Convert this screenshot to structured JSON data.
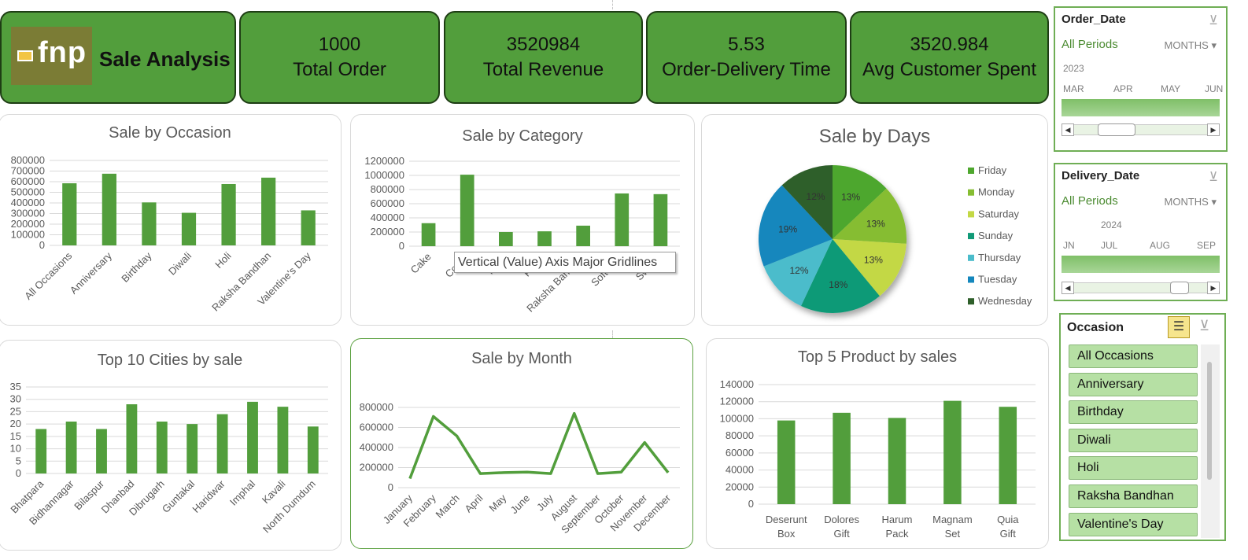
{
  "brand": {
    "logo_text": "fnp",
    "title": "Sale Analysis"
  },
  "kpis": [
    {
      "value": "1000",
      "label": "Total Order"
    },
    {
      "value": "3520984",
      "label": "Total Revenue"
    },
    {
      "value": "5.53",
      "label": "Order-Delivery Time"
    },
    {
      "value": "3520.984",
      "label": "Avg Customer Spent"
    }
  ],
  "colors": {
    "bar": "#529e3c",
    "line": "#529e3c",
    "kpi": "#529e3c",
    "kpi_border": "#1e3d14",
    "accent": "#4b8b31"
  },
  "tooltip": "Vertical (Value) Axis Major Gridlines",
  "order_date_slicer": {
    "title": "Order_Date",
    "all_periods": "All Periods",
    "unit": "MONTHS",
    "year": "2023",
    "months": [
      "MAR",
      "APR",
      "MAY",
      "JUN"
    ]
  },
  "delivery_date_slicer": {
    "title": "Delivery_Date",
    "all_periods": "All Periods",
    "unit": "MONTHS",
    "year": "2024",
    "months": [
      "JN",
      "JUL",
      "AUG",
      "SEP"
    ]
  },
  "occasion_slicer": {
    "title": "Occasion",
    "items": [
      "All Occasions",
      "Anniversary",
      "Birthday",
      "Diwali",
      "Holi",
      "Raksha Bandhan",
      "Valentine's Day"
    ]
  },
  "chart_data": [
    {
      "id": "occasion",
      "type": "bar",
      "title": "Sale by Occasion",
      "categories": [
        "All Occasions",
        "Anniversary",
        "Birthday",
        "Diwali",
        "Holi",
        "Raksha Bandhan",
        "Valentine's Day"
      ],
      "values": [
        585000,
        675000,
        405000,
        307000,
        578000,
        638000,
        330000
      ],
      "ylim": [
        0,
        800000
      ],
      "yticks": [
        0,
        100000,
        200000,
        300000,
        400000,
        500000,
        600000,
        700000,
        800000
      ],
      "grid": true,
      "legend": "none"
    },
    {
      "id": "category",
      "type": "bar",
      "title": "Sale by Category",
      "categories": [
        "Cake",
        "Colors",
        "Mugs",
        "Plants",
        "Raksha Bandhan",
        "Soft Toys",
        "Sweets"
      ],
      "values": [
        325000,
        1010000,
        200000,
        210000,
        290000,
        745000,
        735000
      ],
      "ylim": [
        0,
        1200000
      ],
      "yticks": [
        0,
        200000,
        400000,
        600000,
        800000,
        1000000,
        1200000
      ],
      "grid": true,
      "legend": "none"
    },
    {
      "id": "days",
      "type": "pie",
      "title": "Sale by Days",
      "categories": [
        "Friday",
        "Monday",
        "Saturday",
        "Sunday",
        "Thursday",
        "Tuesday",
        "Wednesday"
      ],
      "values": [
        13,
        13,
        13,
        18,
        12,
        19,
        12
      ],
      "labels": [
        "13%",
        "13%",
        "13%",
        "18%",
        "12%",
        "19%",
        "12%"
      ],
      "colors": [
        "#4ea72e",
        "#86bd32",
        "#c3d845",
        "#109a77",
        "#4bbccb",
        "#1487bd",
        "#2e5f2a"
      ],
      "legend": "right"
    },
    {
      "id": "cities",
      "type": "bar",
      "title": "Top 10 Cities by sale",
      "categories": [
        "Bhatpara",
        "Bidhannagar",
        "Bilaspur",
        "Dhanbad",
        "Dibrugarh",
        "Guntakal",
        "Haridwar",
        "Imphal",
        "Kavali",
        "North Dumdum"
      ],
      "values": [
        18,
        21,
        18,
        28,
        21,
        20,
        24,
        29,
        27,
        19
      ],
      "ylim": [
        0,
        35
      ],
      "yticks": [
        0,
        5,
        10,
        15,
        20,
        25,
        30,
        35
      ],
      "grid": true,
      "legend": "none"
    },
    {
      "id": "month",
      "type": "line",
      "title": "Sale by Month",
      "categories": [
        "January",
        "February",
        "March",
        "April",
        "May",
        "June",
        "July",
        "August",
        "September",
        "October",
        "November",
        "December"
      ],
      "values": [
        90000,
        710000,
        515000,
        140000,
        150000,
        155000,
        140000,
        740000,
        140000,
        155000,
        450000,
        150000
      ],
      "ylim": [
        0,
        800000
      ],
      "yticks": [
        0,
        200000,
        400000,
        600000,
        800000
      ],
      "grid": true,
      "legend": "none"
    },
    {
      "id": "products",
      "type": "bar",
      "title": "Top 5 Product by sales",
      "categories": [
        "Deserunt Box",
        "Dolores Gift",
        "Harum Pack",
        "Magnam Set",
        "Quia Gift"
      ],
      "values": [
        98000,
        107000,
        101000,
        121000,
        114000
      ],
      "ylim": [
        0,
        140000
      ],
      "yticks": [
        0,
        20000,
        40000,
        60000,
        80000,
        100000,
        120000,
        140000
      ],
      "grid": true,
      "legend": "none"
    }
  ]
}
